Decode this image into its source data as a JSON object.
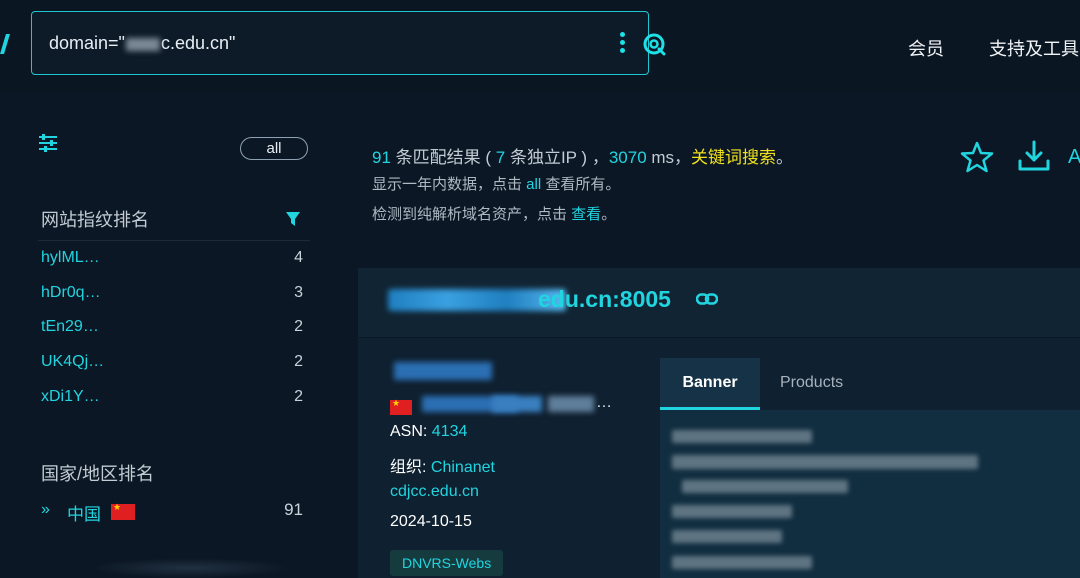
{
  "search": {
    "query_prefix": "domain=\"",
    "query_suffix": "c.edu.cn\""
  },
  "nav": {
    "member": "会员",
    "tools": "支持及工具"
  },
  "sidebar": {
    "all_label": "all",
    "fingerprint_title": "网站指纹排名",
    "fingerprints": [
      {
        "name": "hylML…",
        "count": "4"
      },
      {
        "name": "hDr0q…",
        "count": "3"
      },
      {
        "name": "tEn29…",
        "count": "2"
      },
      {
        "name": "UK4Qj…",
        "count": "2"
      },
      {
        "name": "xDi1Y…",
        "count": "2"
      }
    ],
    "country_title": "国家/地区排名",
    "countries": [
      {
        "name": "中国",
        "count": "91",
        "flag_color": "#e02020"
      }
    ]
  },
  "summary": {
    "count": "91",
    "matches": " 条匹配结果 ( ",
    "unique_ip": "7",
    "unique_ip_suffix": " 条独立IP ) ，",
    "ms": "3070",
    "ms_suffix": " ms，",
    "keyword": "关键词搜索",
    "end": "。",
    "line2_prefix": "显示一年内数据，点击 ",
    "line2_link": "all",
    "line2_suffix": " 查看所有。",
    "line3_prefix": "检测到纯解析域名资产，点击 ",
    "line3_link": "查看",
    "line3_suffix": "。",
    "cut_text": "A"
  },
  "result": {
    "host": "edu.cn:8005",
    "asn_label": "ASN: ",
    "asn_value": "4134",
    "org_label": "组织: ",
    "org_value": "Chinanet",
    "domain": "cdjcc.edu.cn",
    "date": "2024-10-15",
    "tag": "DNVRS-Webs",
    "ellipsis": "…",
    "tabs": [
      "Banner",
      "Products"
    ]
  },
  "icons": {
    "accent": "#21d5e0",
    "keyword": "#f0e01e",
    "names": [
      "kebab-icon",
      "scan-search-icon",
      "filter-settings-icon",
      "funnel-icon",
      "star-icon",
      "download-icon",
      "link-icon",
      "china-flag-icon"
    ]
  }
}
